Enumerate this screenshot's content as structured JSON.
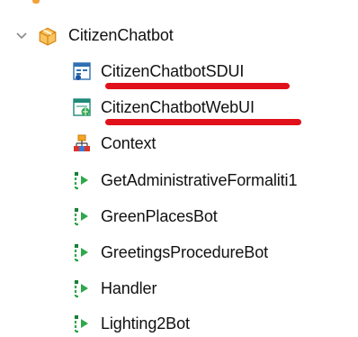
{
  "tree": {
    "root": {
      "label": "CitizenChatbot",
      "expanded": true
    },
    "items": [
      {
        "label": "CitizenChatbotSDUI",
        "icon": "sd-panel-icon",
        "highlighted": true
      },
      {
        "label": "CitizenChatbotWebUI",
        "icon": "web-panel-icon",
        "highlighted": true
      },
      {
        "label": "Context",
        "icon": "context-structure-icon",
        "highlighted": false
      },
      {
        "label": "GetAdministrativeFormaliti1",
        "icon": "procedure-icon",
        "highlighted": false
      },
      {
        "label": "GreenPlacesBot",
        "icon": "procedure-icon",
        "highlighted": false
      },
      {
        "label": "GreetingsProcedureBot",
        "icon": "procedure-icon",
        "highlighted": false
      },
      {
        "label": "Handler",
        "icon": "procedure-icon",
        "highlighted": false
      },
      {
        "label": "Lighting2Bot",
        "icon": "procedure-icon",
        "highlighted": false
      }
    ]
  },
  "colors": {
    "annotation_underline": "#e0111a",
    "module_icon": "#f2a23b",
    "procedure_icon": "#2ea84a"
  }
}
